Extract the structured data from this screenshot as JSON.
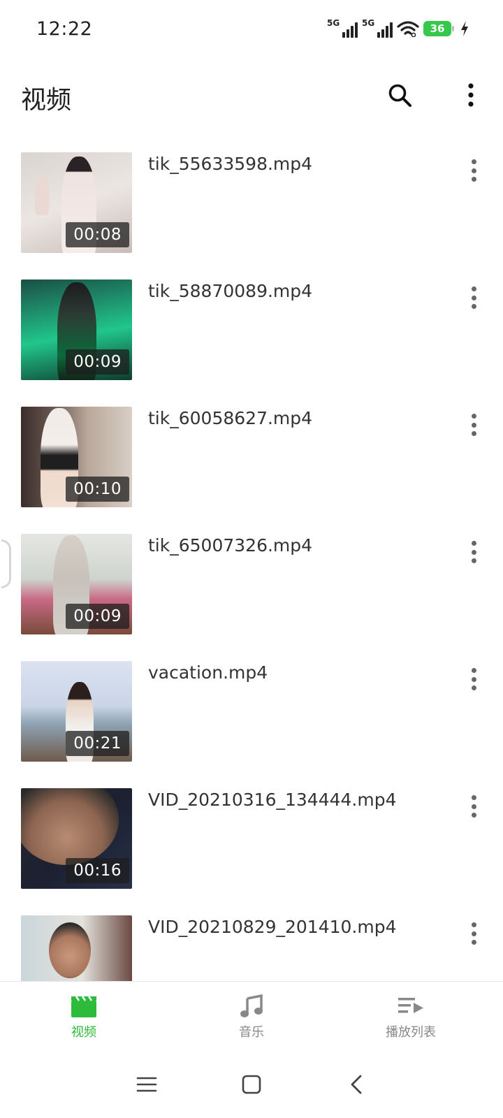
{
  "status_bar": {
    "time": "12:22",
    "signal_1_label": "5G",
    "signal_2_label": "5G",
    "battery_level": "36",
    "icons": [
      "signal-5g-icon",
      "signal-5g-icon",
      "wifi-icon",
      "battery-icon",
      "charging-icon"
    ]
  },
  "header": {
    "title": "视频",
    "search_icon": "search-icon",
    "more_icon": "more-vertical-icon"
  },
  "videos": [
    {
      "name": "tik_55633598.mp4",
      "duration": "00:08"
    },
    {
      "name": "tik_58870089.mp4",
      "duration": "00:09"
    },
    {
      "name": "tik_60058627.mp4",
      "duration": "00:10"
    },
    {
      "name": "tik_65007326.mp4",
      "duration": "00:09"
    },
    {
      "name": "vacation.mp4",
      "duration": "00:21"
    },
    {
      "name": "VID_20210316_134444.mp4",
      "duration": "00:16"
    },
    {
      "name": "VID_20210829_201410.mp4",
      "duration": ""
    }
  ],
  "bottom_nav": {
    "items": [
      {
        "label": "视频",
        "icon": "clapperboard-icon",
        "active": true
      },
      {
        "label": "音乐",
        "icon": "music-note-icon",
        "active": false
      },
      {
        "label": "播放列表",
        "icon": "playlist-icon",
        "active": false
      }
    ]
  },
  "colors": {
    "accent": "#2dbb3c",
    "text": "#222222",
    "inactive": "#888888"
  }
}
